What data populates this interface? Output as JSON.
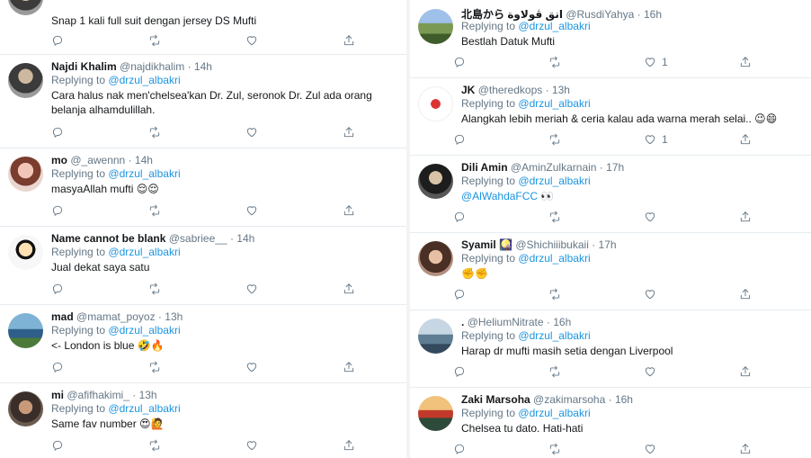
{
  "left": {
    "top_tweet": {
      "text": "Snap 1 kali full suit dengan jersey DS Mufti"
    },
    "tweets": [
      {
        "name": "Najdi Khalim",
        "handle": "@najdikhalim",
        "time": "14h",
        "reply_prefix": "Replying to",
        "reply_to": "@drzul_albakri",
        "text": "Cara halus nak men'chelsea'kan Dr. Zul, seronok Dr. Zul ada orang belanja alhamdulillah.",
        "likes": "",
        "avatar": "img1"
      },
      {
        "name": "mo",
        "handle": "@_awennn",
        "time": "14h",
        "reply_prefix": "Replying to",
        "reply_to": "@drzul_albakri",
        "text": "masyaAllah mufti 😌😌",
        "likes": "",
        "avatar": "img2"
      },
      {
        "name": "Name cannot be blank",
        "handle": "@sabriee__",
        "time": "14h",
        "reply_prefix": "Replying to",
        "reply_to": "@drzul_albakri",
        "text": "Jual dekat saya satu",
        "likes": "",
        "avatar": "img3"
      },
      {
        "name": "mad",
        "handle": "@mamat_poyoz",
        "time": "13h",
        "reply_prefix": "Replying to",
        "reply_to": "@drzul_albakri",
        "text": "<- London is blue 🤣🔥",
        "likes": "",
        "avatar": "img4"
      },
      {
        "name": "mi",
        "handle": "@afifhakimi_",
        "time": "13h",
        "reply_prefix": "Replying to",
        "reply_to": "@drzul_albakri",
        "text": "Same fav number 😍🙋",
        "likes": "",
        "avatar": "img5"
      }
    ]
  },
  "right": {
    "tweets": [
      {
        "name": "北島から انق ڤولاوة",
        "handle": "@RusdiYahya",
        "time": "16h",
        "reply_prefix": "Replying to",
        "reply_to": "@drzul_albakri",
        "text": "Bestlah Datuk Mufti",
        "likes": "1",
        "avatar": "img6"
      },
      {
        "name": "JK",
        "handle": "@theredkops",
        "time": "13h",
        "reply_prefix": "Replying to",
        "reply_to": "@drzul_albakri",
        "text": "Alangkah lebih meriah & ceria kalau ada warna merah selai.. 😉😄",
        "likes": "1",
        "avatar": "img7"
      },
      {
        "name": "Dili Amin",
        "handle": "@AminZulkarnain",
        "time": "17h",
        "reply_prefix": "Replying to",
        "reply_to": "@drzul_albakri",
        "text": "@AlWahdaFCC 👀",
        "likes": "",
        "avatar": "img8"
      },
      {
        "name": "Syamil 🎑",
        "handle": "@Shichiiibukaii",
        "time": "17h",
        "reply_prefix": "Replying to",
        "reply_to": "@drzul_albakri",
        "text": "✊✊",
        "likes": "",
        "avatar": "img9"
      },
      {
        "name": ".",
        "handle": "@HeliumNitrate",
        "time": "16h",
        "reply_prefix": "Replying to",
        "reply_to": "@drzul_albakri",
        "text": "Harap dr mufti masih setia dengan Liverpool",
        "likes": "",
        "avatar": "img10"
      },
      {
        "name": "Zaki Marsoha",
        "handle": "@zakimarsoha",
        "time": "16h",
        "reply_prefix": "Replying to",
        "reply_to": "@drzul_albakri",
        "text": "Chelsea tu dato. Hati-hati",
        "likes": "",
        "avatar": "img11"
      }
    ]
  },
  "icons": {
    "reply": "reply-icon",
    "retweet": "retweet-icon",
    "like": "like-icon",
    "share": "share-icon"
  }
}
